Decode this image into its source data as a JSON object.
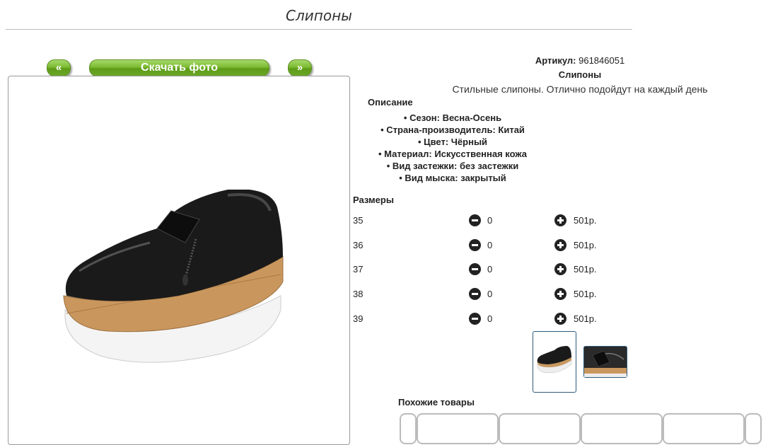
{
  "page": {
    "title": "Слипоны"
  },
  "gallery": {
    "prev_label": "«",
    "download_label": "Скачать фото",
    "next_label": "»"
  },
  "product": {
    "sku_label": "Артикул:",
    "sku_value": "961846051",
    "name": "Слипоны",
    "description": "Стильные слипоны. Отлично подойдут на каждый день",
    "description_heading": "Описание",
    "features": [
      "Сезон: Весна-Осень",
      "Страна-производитель: Китай",
      "Цвет: Чёрный",
      "Материал: Искусственная кожа",
      "Вид застежки: без застежки",
      "Вид мыска: закрытый"
    ]
  },
  "sizes": {
    "heading": "Размеры",
    "rows": [
      {
        "size": "35",
        "qty": "0",
        "price": "501р."
      },
      {
        "size": "36",
        "qty": "0",
        "price": "501р."
      },
      {
        "size": "37",
        "qty": "0",
        "price": "501р."
      },
      {
        "size": "38",
        "qty": "0",
        "price": "501р."
      },
      {
        "size": "39",
        "qty": "0",
        "price": "501р."
      }
    ]
  },
  "similar": {
    "heading": "Похожие товары"
  },
  "colors": {
    "accent_green": "#6aa825",
    "thumb_border": "#2d5a7a"
  }
}
